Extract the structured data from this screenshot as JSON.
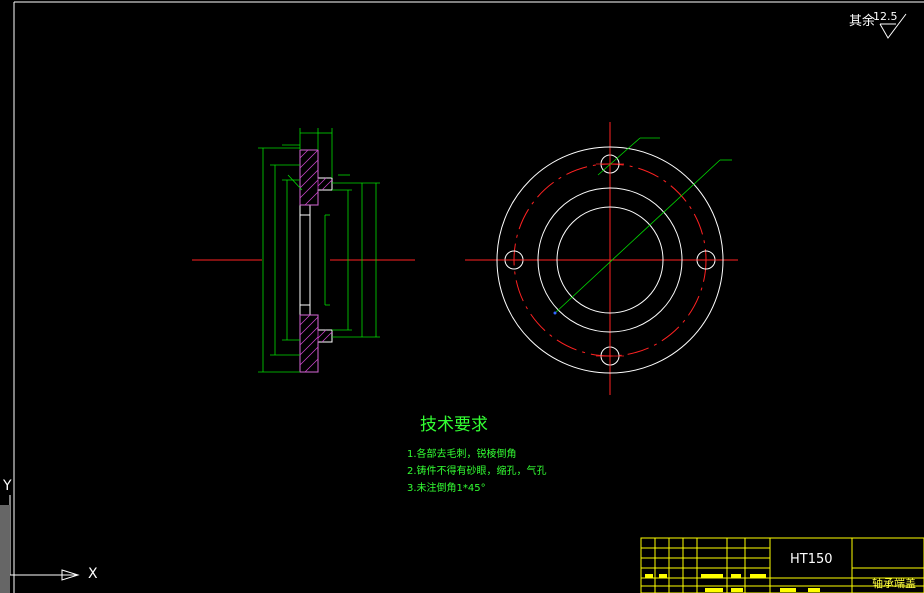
{
  "drawing": {
    "roughness_label": "其余",
    "roughness_value": "12.5",
    "tech_title": "技术要求",
    "notes": [
      "1.各部去毛刺，锐棱倒角",
      "2.铸件不得有砂眼，缩孔，气孔",
      "3.未注倒角1*45°"
    ],
    "material": "HT150",
    "part_name": "轴承端盖",
    "axis_x": "X",
    "axis_y": "Y"
  },
  "colors": {
    "background": "#000000",
    "outline": "#ffffff",
    "dimension": "#00ff00",
    "centerline": "#ff0000",
    "hatch": "#cc44cc",
    "titleblock": "#ffff00"
  }
}
